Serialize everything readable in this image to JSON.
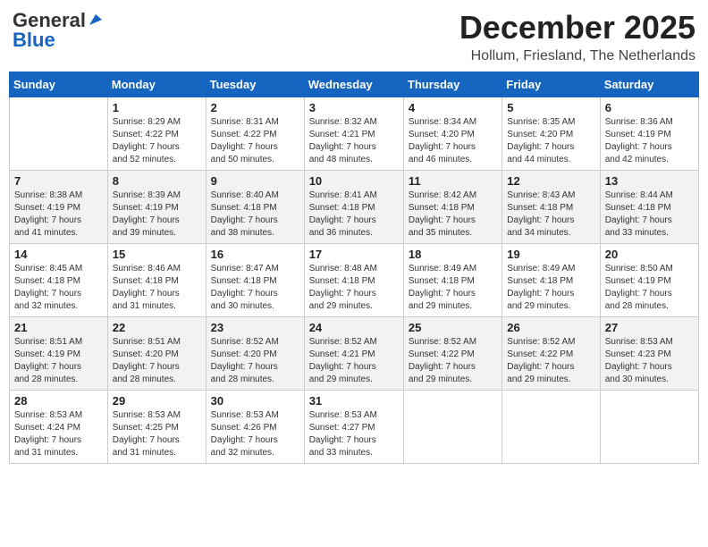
{
  "logo": {
    "line1": "General",
    "line2": "Blue"
  },
  "title": "December 2025",
  "location": "Hollum, Friesland, The Netherlands",
  "weekdays": [
    "Sunday",
    "Monday",
    "Tuesday",
    "Wednesday",
    "Thursday",
    "Friday",
    "Saturday"
  ],
  "weeks": [
    [
      {
        "day": "",
        "info": ""
      },
      {
        "day": "1",
        "info": "Sunrise: 8:29 AM\nSunset: 4:22 PM\nDaylight: 7 hours\nand 52 minutes."
      },
      {
        "day": "2",
        "info": "Sunrise: 8:31 AM\nSunset: 4:22 PM\nDaylight: 7 hours\nand 50 minutes."
      },
      {
        "day": "3",
        "info": "Sunrise: 8:32 AM\nSunset: 4:21 PM\nDaylight: 7 hours\nand 48 minutes."
      },
      {
        "day": "4",
        "info": "Sunrise: 8:34 AM\nSunset: 4:20 PM\nDaylight: 7 hours\nand 46 minutes."
      },
      {
        "day": "5",
        "info": "Sunrise: 8:35 AM\nSunset: 4:20 PM\nDaylight: 7 hours\nand 44 minutes."
      },
      {
        "day": "6",
        "info": "Sunrise: 8:36 AM\nSunset: 4:19 PM\nDaylight: 7 hours\nand 42 minutes."
      }
    ],
    [
      {
        "day": "7",
        "info": "Sunrise: 8:38 AM\nSunset: 4:19 PM\nDaylight: 7 hours\nand 41 minutes."
      },
      {
        "day": "8",
        "info": "Sunrise: 8:39 AM\nSunset: 4:19 PM\nDaylight: 7 hours\nand 39 minutes."
      },
      {
        "day": "9",
        "info": "Sunrise: 8:40 AM\nSunset: 4:18 PM\nDaylight: 7 hours\nand 38 minutes."
      },
      {
        "day": "10",
        "info": "Sunrise: 8:41 AM\nSunset: 4:18 PM\nDaylight: 7 hours\nand 36 minutes."
      },
      {
        "day": "11",
        "info": "Sunrise: 8:42 AM\nSunset: 4:18 PM\nDaylight: 7 hours\nand 35 minutes."
      },
      {
        "day": "12",
        "info": "Sunrise: 8:43 AM\nSunset: 4:18 PM\nDaylight: 7 hours\nand 34 minutes."
      },
      {
        "day": "13",
        "info": "Sunrise: 8:44 AM\nSunset: 4:18 PM\nDaylight: 7 hours\nand 33 minutes."
      }
    ],
    [
      {
        "day": "14",
        "info": "Sunrise: 8:45 AM\nSunset: 4:18 PM\nDaylight: 7 hours\nand 32 minutes."
      },
      {
        "day": "15",
        "info": "Sunrise: 8:46 AM\nSunset: 4:18 PM\nDaylight: 7 hours\nand 31 minutes."
      },
      {
        "day": "16",
        "info": "Sunrise: 8:47 AM\nSunset: 4:18 PM\nDaylight: 7 hours\nand 30 minutes."
      },
      {
        "day": "17",
        "info": "Sunrise: 8:48 AM\nSunset: 4:18 PM\nDaylight: 7 hours\nand 29 minutes."
      },
      {
        "day": "18",
        "info": "Sunrise: 8:49 AM\nSunset: 4:18 PM\nDaylight: 7 hours\nand 29 minutes."
      },
      {
        "day": "19",
        "info": "Sunrise: 8:49 AM\nSunset: 4:18 PM\nDaylight: 7 hours\nand 29 minutes."
      },
      {
        "day": "20",
        "info": "Sunrise: 8:50 AM\nSunset: 4:19 PM\nDaylight: 7 hours\nand 28 minutes."
      }
    ],
    [
      {
        "day": "21",
        "info": "Sunrise: 8:51 AM\nSunset: 4:19 PM\nDaylight: 7 hours\nand 28 minutes."
      },
      {
        "day": "22",
        "info": "Sunrise: 8:51 AM\nSunset: 4:20 PM\nDaylight: 7 hours\nand 28 minutes."
      },
      {
        "day": "23",
        "info": "Sunrise: 8:52 AM\nSunset: 4:20 PM\nDaylight: 7 hours\nand 28 minutes."
      },
      {
        "day": "24",
        "info": "Sunrise: 8:52 AM\nSunset: 4:21 PM\nDaylight: 7 hours\nand 29 minutes."
      },
      {
        "day": "25",
        "info": "Sunrise: 8:52 AM\nSunset: 4:22 PM\nDaylight: 7 hours\nand 29 minutes."
      },
      {
        "day": "26",
        "info": "Sunrise: 8:52 AM\nSunset: 4:22 PM\nDaylight: 7 hours\nand 29 minutes."
      },
      {
        "day": "27",
        "info": "Sunrise: 8:53 AM\nSunset: 4:23 PM\nDaylight: 7 hours\nand 30 minutes."
      }
    ],
    [
      {
        "day": "28",
        "info": "Sunrise: 8:53 AM\nSunset: 4:24 PM\nDaylight: 7 hours\nand 31 minutes."
      },
      {
        "day": "29",
        "info": "Sunrise: 8:53 AM\nSunset: 4:25 PM\nDaylight: 7 hours\nand 31 minutes."
      },
      {
        "day": "30",
        "info": "Sunrise: 8:53 AM\nSunset: 4:26 PM\nDaylight: 7 hours\nand 32 minutes."
      },
      {
        "day": "31",
        "info": "Sunrise: 8:53 AM\nSunset: 4:27 PM\nDaylight: 7 hours\nand 33 minutes."
      },
      {
        "day": "",
        "info": ""
      },
      {
        "day": "",
        "info": ""
      },
      {
        "day": "",
        "info": ""
      }
    ]
  ]
}
